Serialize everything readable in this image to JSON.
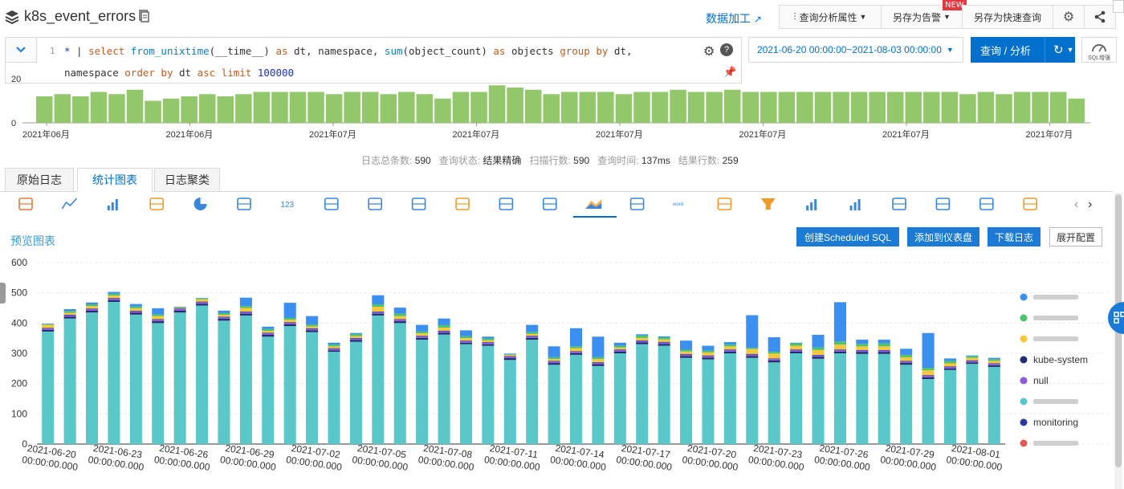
{
  "header": {
    "logstore_name": "k8s_event_errors",
    "data_process": "数据加工",
    "query_props": "查询分析属性",
    "save_alert": "另存为告警",
    "new_badge": "NEW",
    "save_quick": "另存为快速查询"
  },
  "query": {
    "line_number": "1",
    "time_range": "2021-06-20 00:00:00~2021-08-03 00:00:00",
    "run_button": "查询 / 分析",
    "sql_enhance": "SQL增强"
  },
  "histogram": {
    "y_ticks": [
      "20",
      "0"
    ],
    "x_labels": [
      "2021年06月",
      "2021年06月",
      "2021年07月",
      "2021年07月",
      "2021年07月",
      "2021年07月",
      "2021年07月",
      "2021年07月"
    ],
    "values": [
      12,
      13,
      12,
      14,
      13,
      15,
      10,
      11,
      12,
      13,
      12,
      13,
      14,
      14,
      14,
      14,
      13,
      14,
      14,
      13,
      14,
      13,
      11,
      14,
      14,
      17,
      16,
      15,
      13,
      14,
      14,
      14,
      13,
      14,
      14,
      15,
      14,
      14,
      15,
      14,
      14,
      14,
      14,
      14,
      14,
      14,
      14,
      14,
      14,
      14,
      14,
      13,
      14,
      13,
      14,
      14,
      14,
      11
    ]
  },
  "status": {
    "total_label": "日志总条数:",
    "total": "590",
    "state_label": "查询状态:",
    "state": "结果精确",
    "scan_label": "扫描行数:",
    "scan": "590",
    "time_label": "查询时间:",
    "time": "137ms",
    "rows_label": "结果行数:",
    "rows": "259"
  },
  "tabs": [
    "原始日志",
    "统计图表",
    "日志聚类"
  ],
  "panel": {
    "preview_title": "预览图表",
    "btn_scheduled": "创建Scheduled SQL",
    "btn_dashboard": "添加到仪表盘",
    "btn_download": "下载日志",
    "btn_expand": "展开配置"
  },
  "chart_data": {
    "type": "bar",
    "stacked": true,
    "ylim": [
      0,
      600
    ],
    "y_ticks": [
      0,
      100,
      200,
      300,
      400,
      500,
      600
    ],
    "grid": true,
    "legend_position": "right",
    "categories": [
      "2021-06-20 00:00:00.000",
      "2021-06-21 00:00:00.000",
      "2021-06-22 00:00:00.000",
      "2021-06-23 00:00:00.000",
      "2021-06-24 00:00:00.000",
      "2021-06-25 00:00:00.000",
      "2021-06-26 00:00:00.000",
      "2021-06-27 00:00:00.000",
      "2021-06-28 00:00:00.000",
      "2021-06-29 00:00:00.000",
      "2021-06-30 00:00:00.000",
      "2021-07-01 00:00:00.000",
      "2021-07-02 00:00:00.000",
      "2021-07-03 00:00:00.000",
      "2021-07-04 00:00:00.000",
      "2021-07-05 00:00:00.000",
      "2021-07-06 00:00:00.000",
      "2021-07-07 00:00:00.000",
      "2021-07-08 00:00:00.000",
      "2021-07-09 00:00:00.000",
      "2021-07-10 00:00:00.000",
      "2021-07-11 00:00:00.000",
      "2021-07-12 00:00:00.000",
      "2021-07-13 00:00:00.000",
      "2021-07-14 00:00:00.000",
      "2021-07-15 00:00:00.000",
      "2021-07-16 00:00:00.000",
      "2021-07-17 00:00:00.000",
      "2021-07-18 00:00:00.000",
      "2021-07-19 00:00:00.000",
      "2021-07-20 00:00:00.000",
      "2021-07-21 00:00:00.000",
      "2021-07-22 00:00:00.000",
      "2021-07-23 00:00:00.000",
      "2021-07-24 00:00:00.000",
      "2021-07-25 00:00:00.000",
      "2021-07-26 00:00:00.000",
      "2021-07-27 00:00:00.000",
      "2021-07-28 00:00:00.000",
      "2021-07-29 00:00:00.000",
      "2021-07-30 00:00:00.000",
      "2021-07-31 00:00:00.000",
      "2021-08-01 00:00:00.000",
      "2021-08-02 00:00:00.000"
    ],
    "x_tick_labels": [
      "2021-06-20 00:00:00.000",
      "2021-06-23 00:00:00.000",
      "2021-06-26 00:00:00.000",
      "2021-06-29 00:00:00.000",
      "2021-07-02 00:00:00.000",
      "2021-07-05 00:00:00.000",
      "2021-07-08 00:00:00.000",
      "2021-07-11 00:00:00.000",
      "2021-07-14 00:00:00.000",
      "2021-07-17 00:00:00.000",
      "2021-07-20 00:00:00.000",
      "2021-07-23 00:00:00.000",
      "2021-07-26 00:00:00.000",
      "2021-07-29 00:00:00.000",
      "2021-08-01 00:00:00.000"
    ],
    "series": [
      {
        "name": "kube-system",
        "color": "#1f2d6e",
        "values": [
          5,
          6,
          6,
          6,
          6,
          6,
          6,
          6,
          6,
          6,
          6,
          6,
          5,
          5,
          6,
          6,
          6,
          6,
          6,
          5,
          5,
          6,
          6,
          6,
          5,
          6,
          6,
          6,
          6,
          6,
          6,
          6,
          6,
          6,
          6,
          6,
          6,
          6,
          6,
          6,
          6,
          5,
          5,
          5
        ]
      },
      {
        "name": "null",
        "color": "#8a5ad8",
        "values": [
          5,
          5,
          5,
          5,
          5,
          5,
          5,
          5,
          5,
          5,
          5,
          5,
          5,
          5,
          5,
          5,
          5,
          5,
          5,
          5,
          5,
          5,
          5,
          5,
          5,
          5,
          5,
          5,
          5,
          5,
          5,
          5,
          5,
          5,
          5,
          5,
          5,
          5,
          5,
          5,
          5,
          5,
          5,
          5
        ]
      },
      {
        "name": "monitoring",
        "color": "#2b3a9e",
        "values": [
          2,
          2,
          2,
          2,
          2,
          2,
          2,
          2,
          2,
          2,
          2,
          2,
          2,
          2,
          2,
          2,
          2,
          2,
          2,
          2,
          2,
          2,
          2,
          2,
          2,
          2,
          2,
          2,
          2,
          2,
          2,
          2,
          2,
          2,
          2,
          2,
          2,
          2,
          2,
          2,
          2,
          2,
          2,
          2
        ]
      }
    ]
  },
  "chart_bars": [
    [
      372,
      5,
      5,
      2,
      10,
      2,
      2
    ],
    [
      415,
      6,
      5,
      2,
      6,
      6,
      6
    ],
    [
      435,
      6,
      5,
      2,
      8,
      6,
      6
    ],
    [
      470,
      6,
      5,
      2,
      8,
      6,
      6
    ],
    [
      428,
      6,
      5,
      2,
      8,
      6,
      8
    ],
    [
      400,
      6,
      5,
      2,
      10,
      6,
      20
    ],
    [
      435,
      6,
      5,
      2,
      2,
      2,
      2
    ],
    [
      458,
      6,
      5,
      2,
      8,
      2,
      2
    ],
    [
      408,
      6,
      5,
      2,
      6,
      6,
      8
    ],
    [
      425,
      6,
      5,
      2,
      12,
      6,
      28
    ],
    [
      355,
      6,
      5,
      2,
      6,
      6,
      8
    ],
    [
      390,
      6,
      5,
      2,
      8,
      6,
      50
    ],
    [
      370,
      6,
      5,
      2,
      6,
      6,
      28
    ],
    [
      305,
      5,
      5,
      2,
      6,
      6,
      6
    ],
    [
      338,
      6,
      5,
      2,
      6,
      6,
      4
    ],
    [
      425,
      6,
      5,
      2,
      16,
      8,
      30
    ],
    [
      400,
      6,
      5,
      2,
      10,
      8,
      20
    ],
    [
      345,
      6,
      5,
      2,
      8,
      6,
      22
    ],
    [
      362,
      6,
      5,
      2,
      10,
      8,
      22
    ],
    [
      330,
      5,
      5,
      2,
      8,
      6,
      20
    ],
    [
      325,
      5,
      5,
      2,
      6,
      6,
      6
    ],
    [
      278,
      6,
      5,
      2,
      4,
      2,
      2
    ],
    [
      345,
      6,
      5,
      2,
      6,
      6,
      24
    ],
    [
      262,
      6,
      5,
      2,
      6,
      6,
      36
    ],
    [
      295,
      5,
      5,
      2,
      10,
      6,
      60
    ],
    [
      258,
      6,
      5,
      2,
      10,
      6,
      68
    ],
    [
      300,
      6,
      5,
      2,
      6,
      6,
      10
    ],
    [
      330,
      6,
      5,
      2,
      8,
      8,
      4
    ],
    [
      325,
      6,
      5,
      2,
      8,
      6,
      4
    ],
    [
      285,
      6,
      5,
      2,
      8,
      6,
      30
    ],
    [
      280,
      6,
      5,
      2,
      10,
      6,
      16
    ],
    [
      300,
      6,
      5,
      2,
      10,
      6,
      8
    ],
    [
      285,
      6,
      5,
      2,
      16,
      4,
      108
    ],
    [
      270,
      6,
      5,
      2,
      16,
      6,
      48
    ],
    [
      300,
      6,
      5,
      2,
      12,
      8,
      2
    ],
    [
      282,
      6,
      5,
      2,
      16,
      8,
      42
    ],
    [
      300,
      6,
      5,
      2,
      16,
      10,
      130
    ],
    [
      298,
      6,
      5,
      2,
      12,
      8,
      14
    ],
    [
      298,
      6,
      5,
      2,
      12,
      10,
      12
    ],
    [
      262,
      6,
      5,
      2,
      12,
      8,
      20
    ],
    [
      215,
      6,
      5,
      2,
      16,
      8,
      115
    ],
    [
      245,
      5,
      5,
      2,
      10,
      8,
      8
    ],
    [
      265,
      5,
      5,
      2,
      8,
      6,
      2
    ],
    [
      255,
      5,
      5,
      2,
      8,
      6,
      4
    ]
  ],
  "legend_icons": [
    "blue-dot-icon",
    "green-dot-icon",
    "yellow-dot-icon",
    "navy-dot-icon",
    "purple-dot-icon",
    "teal-dot-icon",
    "indigo-dot-icon",
    "red-dot-icon"
  ],
  "legend_labels": [
    "",
    "",
    "",
    "kube-system",
    "null",
    "",
    "monitoring",
    ""
  ],
  "legend_colors": [
    "#3b8ff0",
    "#4cc36a",
    "#f5c93a",
    "#1f2d6e",
    "#8a5ad8",
    "#5ac8c8",
    "#2b3a9e",
    "#e05a5a"
  ],
  "icons": {
    "chart_types": [
      "table-chart-icon",
      "line-chart-icon",
      "bar-chart-icon",
      "horizontal-bar-icon",
      "pie-chart-icon",
      "area-chart-icon",
      "single-value-icon",
      "progress-bar-icon",
      "map-dots-icon",
      "china-map-icon",
      "world-map-icon",
      "amap-icon",
      "flow-chart-icon",
      "stacked-bar-icon",
      "sankey-icon",
      "word-cloud-icon",
      "treemap-icon",
      "funnel-icon",
      "boxplot-icon",
      "column-icon",
      "cross-table-icon",
      "tree-icon",
      "map-icon",
      "location-icon"
    ]
  }
}
